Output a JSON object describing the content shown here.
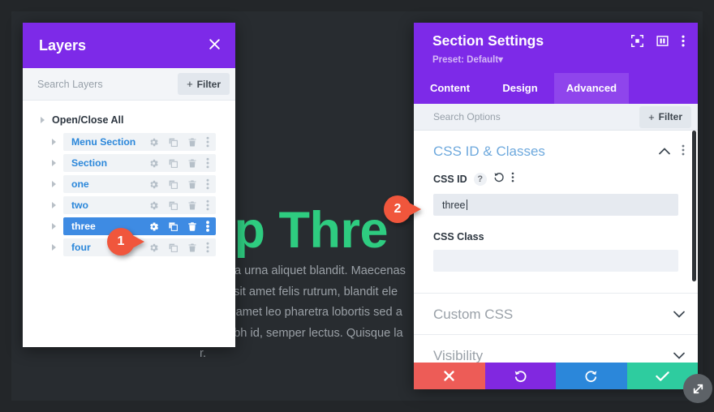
{
  "background": {
    "hero_title": "ep Thre",
    "hero_paragraph": "t risus a urna aliquet blandit. Maecenas\nlectus sit amet felis rutrum, blandit ele\nrtor sit amet leo pharetra lobortis sed a\nvida nibh id, semper lectus. Quisque la\nr.",
    "title_color": "#2ecc80",
    "page_bg": "#282c30",
    "frame_bg": "#232629"
  },
  "layers_panel": {
    "title": "Layers",
    "close_icon": "close-icon",
    "search": {
      "value": "",
      "placeholder": "Search Layers"
    },
    "filter_button": {
      "plus": "+",
      "label": "Filter"
    },
    "open_close_all": "Open/Close All",
    "header_color": "#7d2ae8",
    "active_row_color": "#3e8be3",
    "row_label_color": "#2b87da",
    "rows": [
      {
        "label": "Menu Section",
        "active": false
      },
      {
        "label": "Section",
        "active": false
      },
      {
        "label": "one",
        "active": false
      },
      {
        "label": "two",
        "active": false
      },
      {
        "label": "three",
        "active": true
      },
      {
        "label": "four",
        "active": false
      }
    ],
    "row_actions": [
      "gear-icon",
      "duplicate-icon",
      "trash-icon",
      "more-vertical-icon"
    ]
  },
  "settings_panel": {
    "title": "Section Settings",
    "preset": "Preset: Default",
    "preset_caret": "▾",
    "header_icons": [
      "focus-target-icon",
      "layout-columns-icon",
      "more-vertical-icon"
    ],
    "tabs": [
      {
        "label": "Content",
        "active": false
      },
      {
        "label": "Design",
        "active": false
      },
      {
        "label": "Advanced",
        "active": true
      }
    ],
    "search": {
      "value": "",
      "placeholder": "Search Options"
    },
    "filter_button": {
      "plus": "+",
      "label": "Filter"
    },
    "groups": [
      {
        "label": "CSS ID & Classes",
        "state": "open"
      },
      {
        "label": "Custom CSS",
        "state": "closed"
      },
      {
        "label": "Visibility",
        "state": "closed"
      }
    ],
    "fields": [
      {
        "label": "CSS ID",
        "help_icon": "?",
        "reset_icon": "reset-icon",
        "more_icon": "more-vertical-icon",
        "value": "three",
        "placeholder": "",
        "focused": true
      },
      {
        "label": "CSS Class",
        "value": "",
        "placeholder": "",
        "focused": false
      }
    ],
    "actions": [
      {
        "name": "cancel",
        "icon": "close-icon",
        "color": "#ed5c57"
      },
      {
        "name": "undo",
        "icon": "undo-icon",
        "color": "#8128e0"
      },
      {
        "name": "redo",
        "icon": "redo-icon",
        "color": "#2b87da"
      },
      {
        "name": "save",
        "icon": "check-icon",
        "color": "#2ecc9f"
      }
    ],
    "header_color": "#7d2ae8",
    "active_tab_color": "#8f45ec"
  },
  "markers": [
    {
      "number": "1"
    },
    {
      "number": "2"
    }
  ],
  "resize_handle": "resize-diagonal-icon"
}
